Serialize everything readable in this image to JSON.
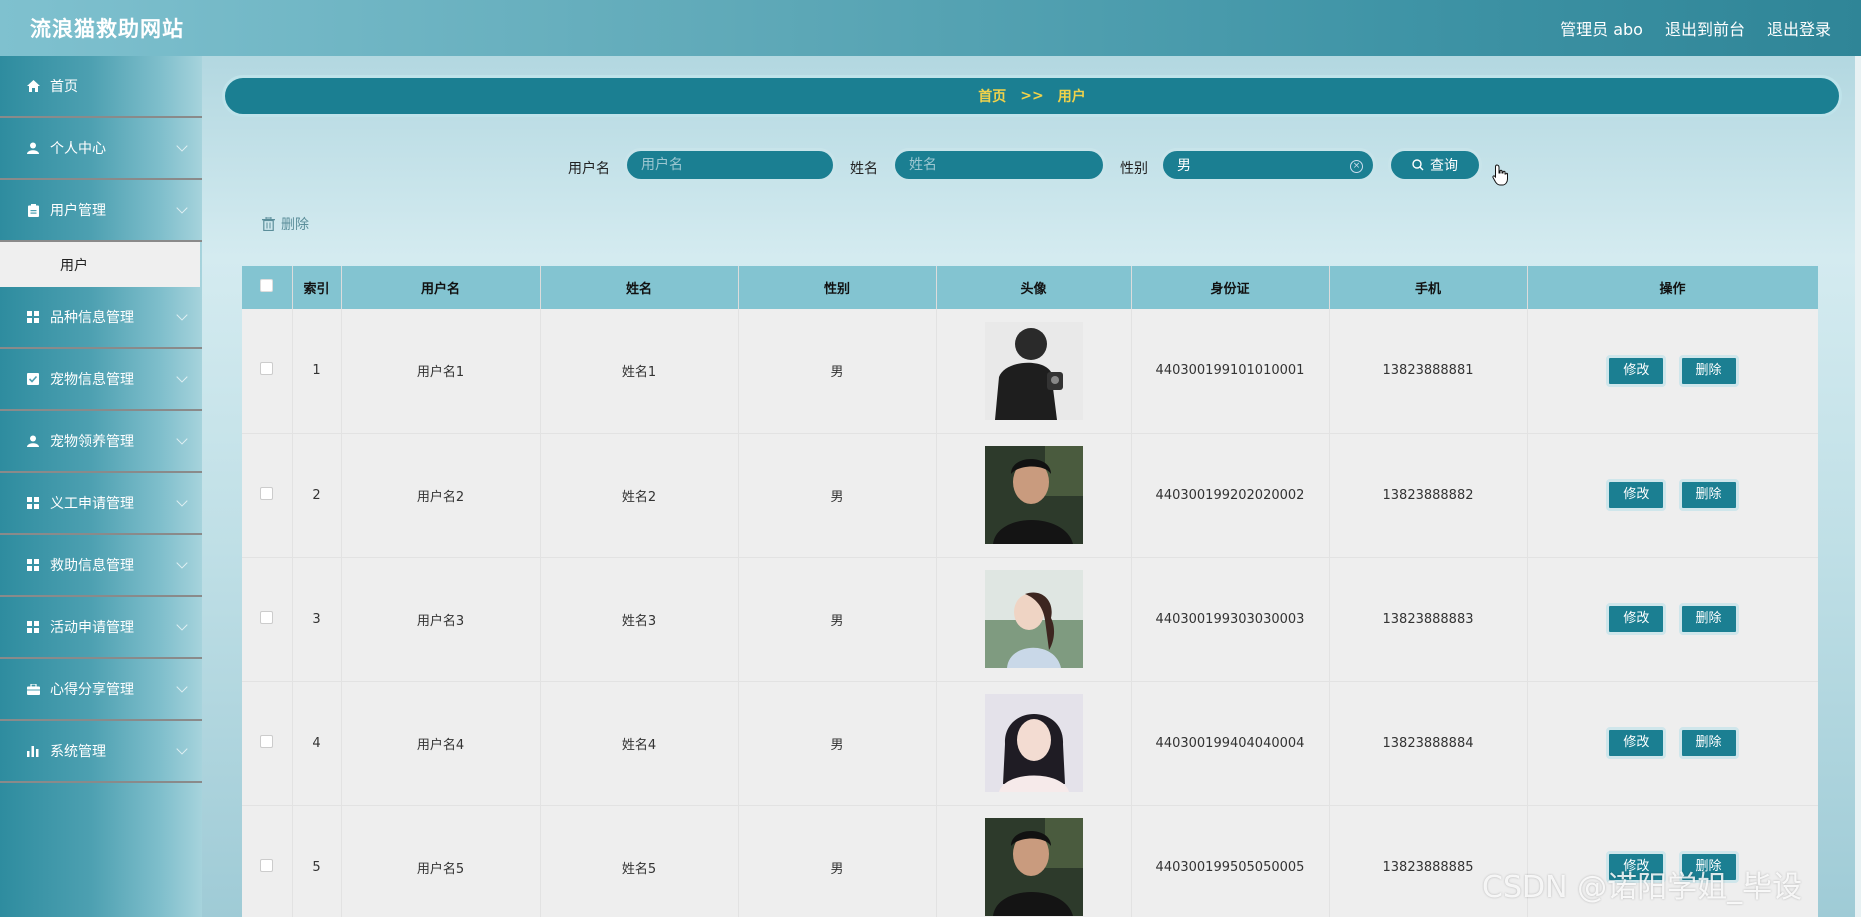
{
  "header": {
    "title": "流浪猫救助网站",
    "user": "管理员 abo",
    "to_front": "退出到前台",
    "logout": "退出登录"
  },
  "sidebar": {
    "items": [
      {
        "label": "首页",
        "icon": "home-icon"
      },
      {
        "label": "个人中心",
        "icon": "user-icon"
      },
      {
        "label": "用户管理",
        "icon": "clipboard-icon"
      },
      {
        "label": "品种信息管理",
        "icon": "grid-icon"
      },
      {
        "label": "宠物信息管理",
        "icon": "check-square-icon"
      },
      {
        "label": "宠物领养管理",
        "icon": "user-icon"
      },
      {
        "label": "义工申请管理",
        "icon": "grid-icon"
      },
      {
        "label": "救助信息管理",
        "icon": "grid-icon"
      },
      {
        "label": "活动申请管理",
        "icon": "grid-icon"
      },
      {
        "label": "心得分享管理",
        "icon": "briefcase-icon"
      },
      {
        "label": "系统管理",
        "icon": "bar-chart-icon"
      }
    ],
    "active_sub": "用户"
  },
  "breadcrumb": {
    "home": "首页",
    "sep": ">>",
    "current": "用户"
  },
  "search": {
    "username_label": "用户名",
    "username_placeholder": "用户名",
    "name_label": "姓名",
    "name_placeholder": "姓名",
    "gender_label": "性别",
    "gender_value": "男",
    "query_button": "查询"
  },
  "toolbar": {
    "delete_label": "删除"
  },
  "table": {
    "headers": [
      "索引",
      "用户名",
      "姓名",
      "性别",
      "头像",
      "身份证",
      "手机",
      "操作"
    ],
    "edit_label": "修改",
    "delete_label": "删除",
    "rows": [
      {
        "index": "1",
        "username": "用户名1",
        "name": "姓名1",
        "gender": "男",
        "id_card": "440300199101010001",
        "phone": "13823888881"
      },
      {
        "index": "2",
        "username": "用户名2",
        "name": "姓名2",
        "gender": "男",
        "id_card": "440300199202020002",
        "phone": "13823888882"
      },
      {
        "index": "3",
        "username": "用户名3",
        "name": "姓名3",
        "gender": "男",
        "id_card": "440300199303030003",
        "phone": "13823888883"
      },
      {
        "index": "4",
        "username": "用户名4",
        "name": "姓名4",
        "gender": "男",
        "id_card": "440300199404040004",
        "phone": "13823888884"
      },
      {
        "index": "5",
        "username": "用户名5",
        "name": "姓名5",
        "gender": "男",
        "id_card": "440300199505050005",
        "phone": "13823888885"
      }
    ]
  },
  "watermark": "CSDN @诺阳学姐_毕设",
  "colors": {
    "primary": "#1b7f92",
    "header_row": "#83c4d1",
    "breadcrumb_text": "#f0d24a"
  }
}
